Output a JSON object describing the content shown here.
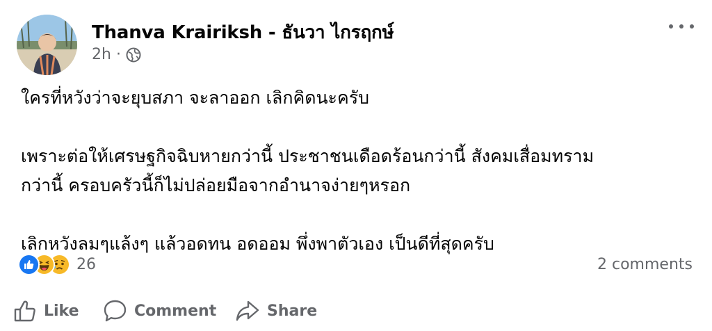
{
  "post": {
    "author": "Thanva Krairiksh - ธันวา ไกรฤกษ์",
    "time": "2h",
    "separator": "·",
    "audience_icon": "globe-icon",
    "paragraphs": [
      "ใครที่หวังว่าจะยุบสภา จะลาออก เลิกคิดนะครับ",
      "เพราะต่อให้เศรษฐกิจฉิบหายกว่านี้ ประชาชนเดือดร้อนกว่านี้ สังคมเสื่อมทราม\nกว่านี้ ครอบครัวนี้ก็ไม่ปล่อยมือจากอำนาจง่ายๆหรอก",
      "เลิกหวังลมๆแล้งๆ แล้วอดทน อดออม พึ่งพาตัวเอง เป็นดีที่สุดครับ"
    ]
  },
  "reactions": {
    "icons": [
      "like-icon",
      "haha-icon",
      "sad-icon"
    ],
    "count": "26",
    "comments": "2 comments"
  },
  "actions": {
    "like": "Like",
    "comment": "Comment",
    "share": "Share"
  },
  "colors": {
    "text": "#050505",
    "secondary": "#65676b",
    "like_blue": "#1877f2",
    "emoji_yellow": "#f7b928"
  }
}
